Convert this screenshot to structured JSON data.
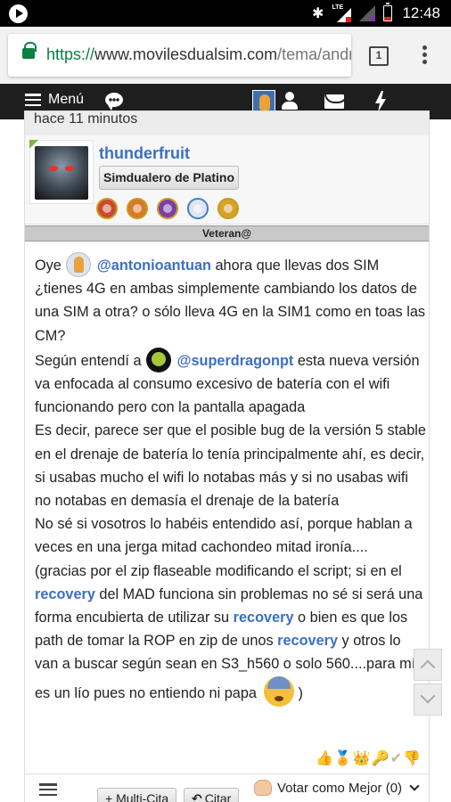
{
  "status_bar": {
    "time": "12:48",
    "network": "LTE"
  },
  "browser": {
    "url_scheme": "https://",
    "url_host": "www.movilesdualsim.com",
    "url_path": "/tema/andro",
    "tab_count": "1"
  },
  "nav": {
    "menu_label": "Menú"
  },
  "post": {
    "timestamp": "hace 11 minutos",
    "username": "thunderfruit",
    "rank": "Simdualero de Platino",
    "title_strip": "Veteran@",
    "body": {
      "p1_a": "Oye ",
      "p1_mention": "@antonioantuan",
      "p1_b": " ahora que llevas dos SIM ¿tienes 4G en ambas simplemente cambiando los datos de una SIM a otra? o sólo lleva 4G en la SIM1 como en toas las CM?",
      "p2_a": "Según entendí a ",
      "p2_mention": "@superdragonpt",
      "p2_b": " esta nueva versión va enfocada al consumo excesivo de batería con el wifi funcionando pero con la pantalla apagada",
      "p3": "Es decir, parece ser que el posible bug de la versión 5 stable en el drenaje de batería lo tenía principalmente ahí, es decir, si usabas mucho el wifi lo notabas más y si no usabas wifi no notabas en demasía el drenaje de la batería",
      "p4": "No sé si vosotros lo habéis entendido así, porque hablan a veces en una jerga mitad cachondeo mitad ironía....",
      "p5_a": "(gracias por el zip flaseable modificando el script; si en el ",
      "p5_link1": "recovery",
      "p5_b": " del MAD funciona sin problemas no sé si será una forma encubierta de utilizar su ",
      "p5_link2": "recovery",
      "p5_c": " o bien es que los path de tomar la ROP en zip de unos ",
      "p5_link3": "recovery",
      "p5_d": " y otros lo van a buscar según sean en S3_h560 o solo 560....para mí es un lío pues no entiendo ni papa ",
      "p5_e": ")"
    }
  },
  "footer": {
    "multi_quote": "+ Multi-Cita",
    "quote": "Citar",
    "vote": "Votar como Mejor (0)"
  },
  "colors": {
    "accent": "#3b6fc7",
    "nav_bg": "#1e1e1e",
    "secure_green": "#0a8043"
  }
}
